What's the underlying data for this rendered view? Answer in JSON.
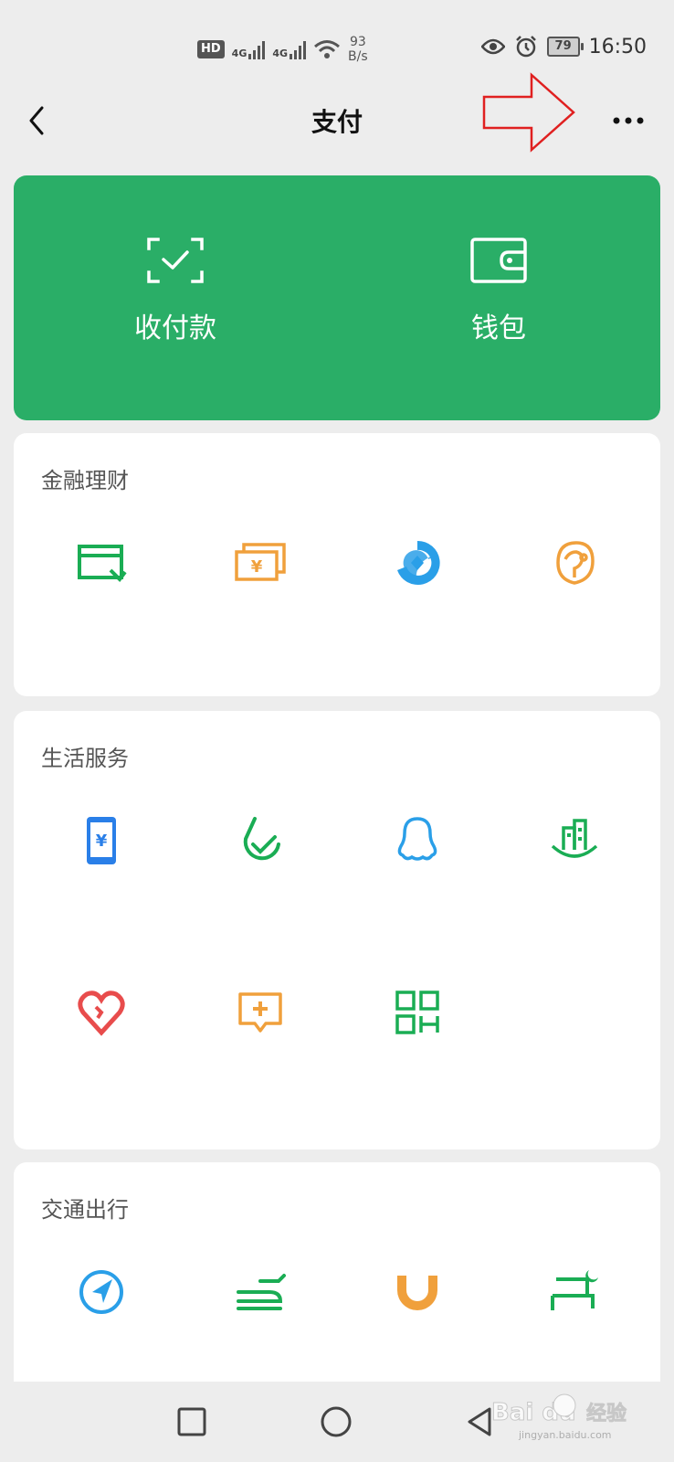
{
  "status_bar": {
    "hd_label": "HD",
    "net1_label": "4G",
    "net2_label": "4G",
    "speed_value": "93",
    "speed_unit": "B/s",
    "battery": "79",
    "time": "16:50"
  },
  "header": {
    "title": "支付"
  },
  "banner": {
    "items": [
      {
        "label": "收付款",
        "icon": "scan-check-icon"
      },
      {
        "label": "钱包",
        "icon": "wallet-icon"
      }
    ]
  },
  "sections": [
    {
      "title": "金融理财"
    },
    {
      "title": "生活服务"
    },
    {
      "title": "交通出行"
    }
  ],
  "watermark": {
    "brand": "Bai du",
    "suffix": "经验",
    "url": "jingyan.baidu.com"
  },
  "colors": {
    "banner_green": "#2aae67",
    "accent_green": "#1aad54",
    "accent_orange": "#f0a03c",
    "accent_blue": "#2a9fe8",
    "accent_red": "#e84c4c",
    "annotation_red": "#e02020"
  }
}
